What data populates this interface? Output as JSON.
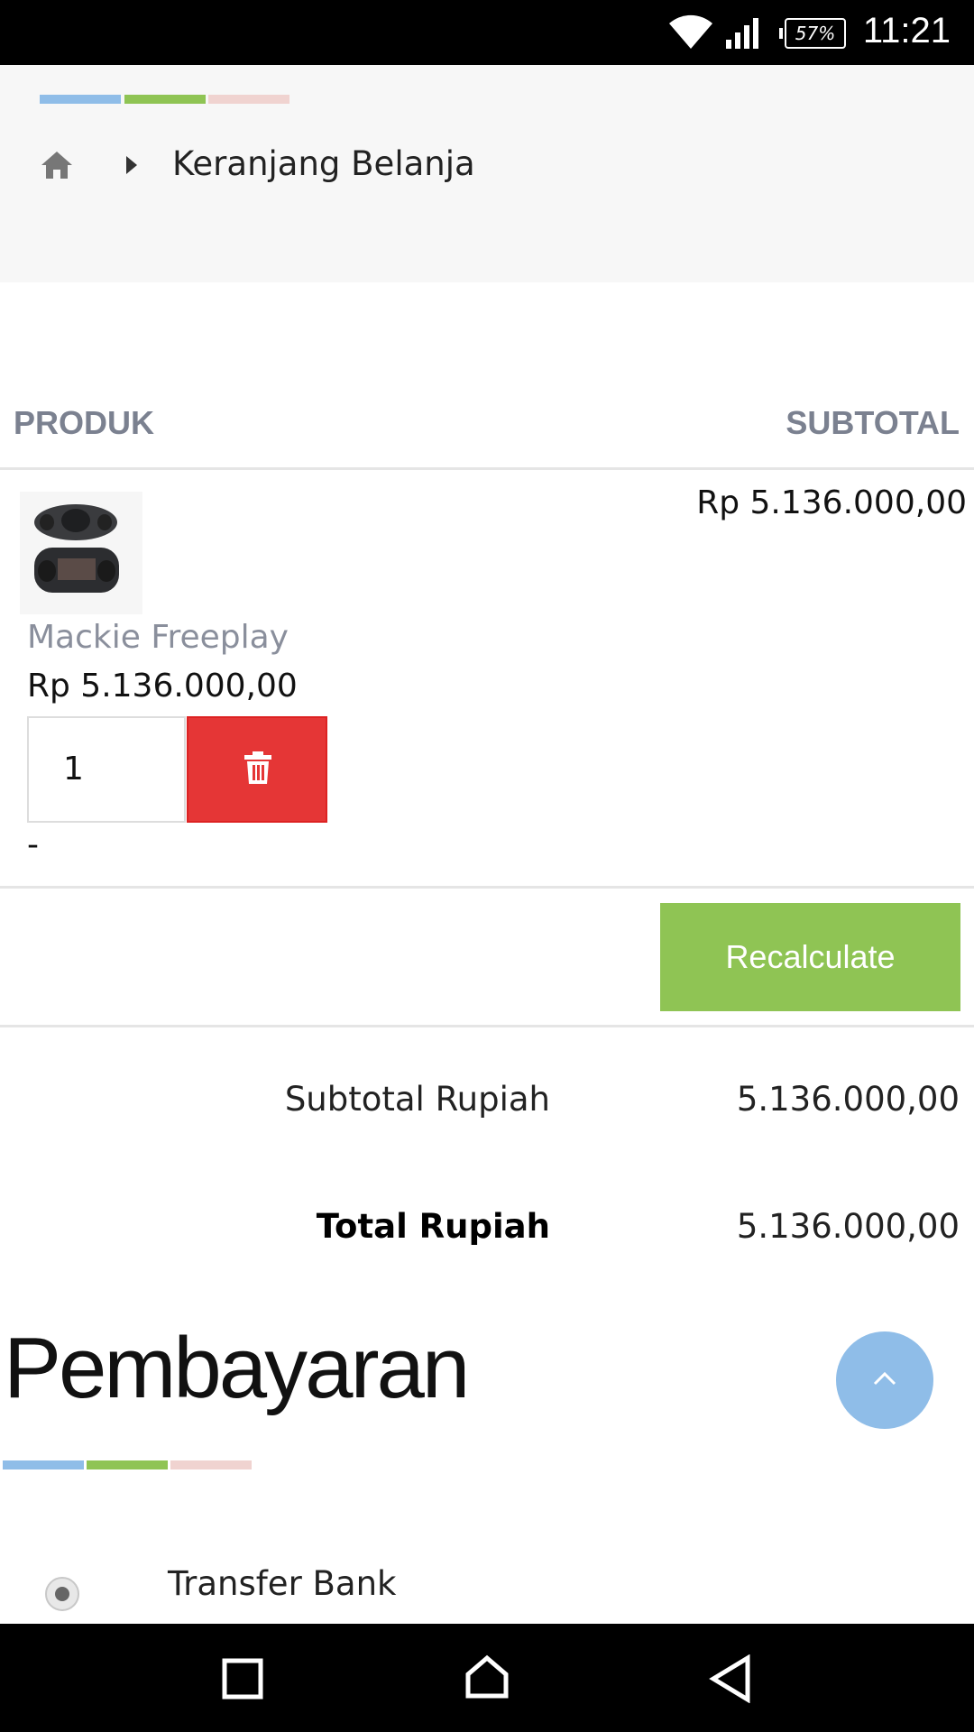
{
  "status_bar": {
    "battery": "57%",
    "time": "11:21"
  },
  "breadcrumb": {
    "current": "Keranjang Belanja"
  },
  "stripe_colors": [
    "#8fbde8",
    "#8fc454",
    "#f0d3d0"
  ],
  "cart": {
    "col_product": "PRODUK",
    "col_subtotal": "SUBTOTAL",
    "item": {
      "name": "Mackie Freeplay",
      "price": "Rp 5.136.000,00",
      "subtotal": "Rp 5.136.000,00",
      "quantity": "1",
      "extra": "-"
    },
    "recalc_label": "Recalculate"
  },
  "totals": {
    "subtotal_label": "Subtotal Rupiah",
    "subtotal_value": "5.136.000,00",
    "total_label": "Total Rupiah",
    "total_value": "5.136.000,00"
  },
  "payment": {
    "title": "Pembayaran",
    "option": "Transfer Bank",
    "option_selected": true
  },
  "icons": {
    "home": "home-icon",
    "breadcrumb_separator": "caret-right-icon",
    "delete": "trash-icon",
    "scroll_top": "chevron-up-icon"
  }
}
